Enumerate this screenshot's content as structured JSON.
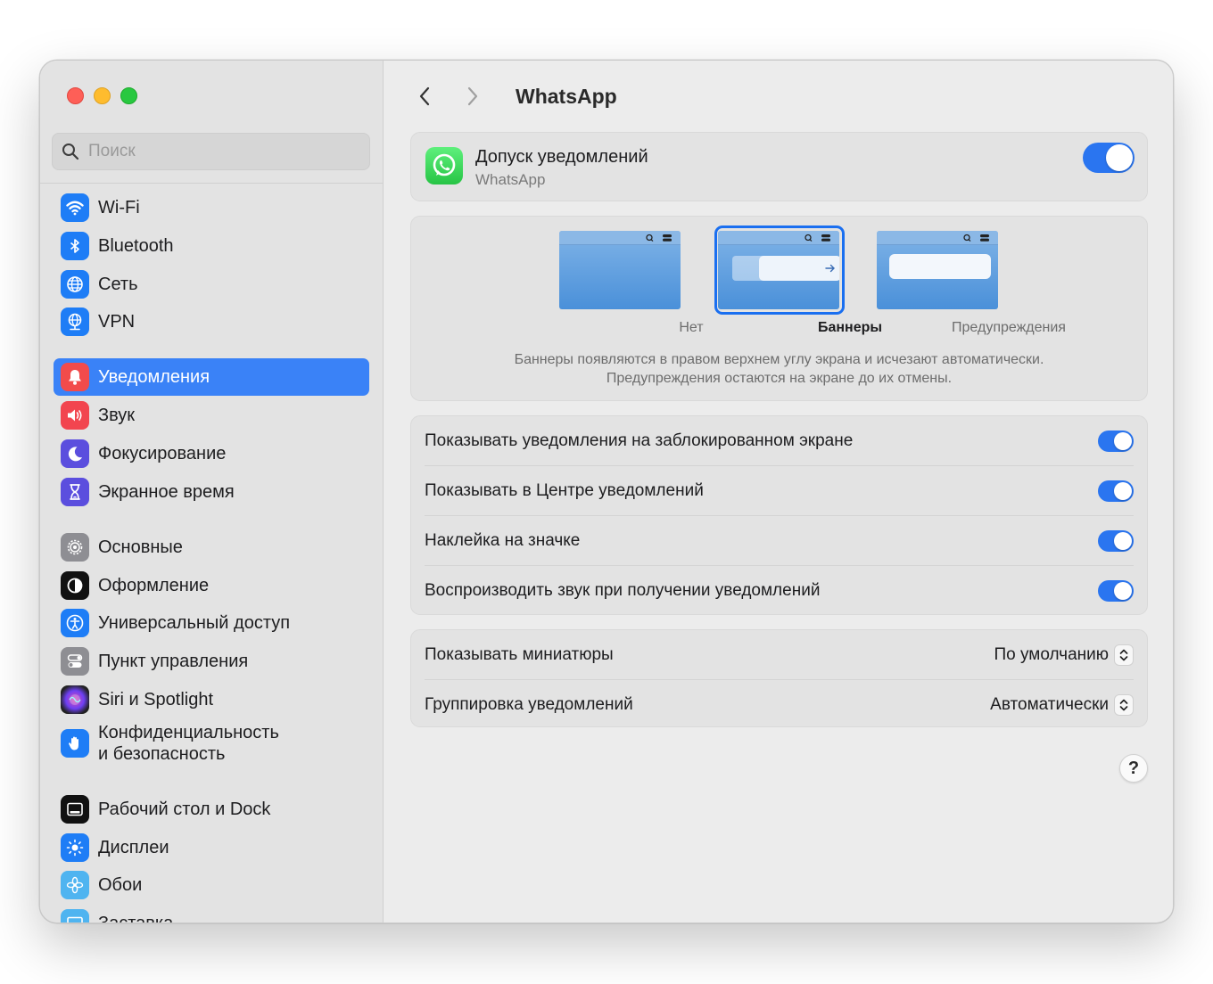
{
  "search": {
    "placeholder": "Поиск"
  },
  "sidebar": {
    "items": [
      {
        "label": "Wi-Fi",
        "icon": "wifi-icon",
        "color": "#1e7df6"
      },
      {
        "label": "Bluetooth",
        "icon": "bluetooth-icon",
        "color": "#1e7df6"
      },
      {
        "label": "Сеть",
        "icon": "globe-icon",
        "color": "#1e7df6"
      },
      {
        "label": "VPN",
        "icon": "vpn-globe-icon",
        "color": "#1e7df6"
      },
      {
        "label": "Уведомления",
        "icon": "bell-icon",
        "color": "#f24b4b",
        "active": true
      },
      {
        "label": "Звук",
        "icon": "speaker-icon",
        "color": "#f2454f"
      },
      {
        "label": "Фокусирование",
        "icon": "moon-icon",
        "color": "#5b4ede"
      },
      {
        "label": "Экранное время",
        "icon": "hourglass-icon",
        "color": "#5b4ede"
      },
      {
        "label": "Основные",
        "icon": "gear-icon",
        "color": "#8e8e93"
      },
      {
        "label": "Оформление",
        "icon": "appearance-icon",
        "color": "#111111"
      },
      {
        "label": "Универсальный доступ",
        "icon": "accessibility-icon",
        "color": "#1e7df6"
      },
      {
        "label": "Пункт управления",
        "icon": "control-center-icon",
        "color": "#8e8e93"
      },
      {
        "label": "Siri и Spotlight",
        "icon": "siri-icon",
        "color": "#3a2a6a"
      },
      {
        "label": "Конфиденциальность",
        "label2": "и безопасность",
        "icon": "hand-icon",
        "color": "#1e7df6"
      },
      {
        "label": "Рабочий стол и Dock",
        "icon": "dock-icon",
        "color": "#111111"
      },
      {
        "label": "Дисплеи",
        "icon": "display-brightness-icon",
        "color": "#1e7df6"
      },
      {
        "label": "Обои",
        "icon": "wallpaper-flower-icon",
        "color": "#4fb4f0"
      },
      {
        "label": "Заставка",
        "icon": "screensaver-icon",
        "color": "#4fb4f0"
      }
    ]
  },
  "header": {
    "title": "WhatsApp"
  },
  "app": {
    "title": "Допуск уведомлений",
    "subtitle": "WhatsApp",
    "allow_enabled": true
  },
  "alert_styles": {
    "options": [
      {
        "label": "Нет"
      },
      {
        "label": "Баннеры",
        "selected": true
      },
      {
        "label": "Предупреждения"
      }
    ],
    "description_line1": "Баннеры появляются в правом верхнем углу экрана и исчезают автоматически.",
    "description_line2": "Предупреждения остаются на экране до их отмены."
  },
  "toggles": [
    {
      "label": "Показывать уведомления на заблокированном экране",
      "enabled": true
    },
    {
      "label": "Показывать в Центре уведомлений",
      "enabled": true
    },
    {
      "label": "Наклейка на значке",
      "enabled": true
    },
    {
      "label": "Воспроизводить звук при получении уведомлений",
      "enabled": true
    }
  ],
  "options": [
    {
      "label": "Показывать миниатюры",
      "value": "По умолчанию"
    },
    {
      "label": "Группировка уведомлений",
      "value": "Автоматически"
    }
  ],
  "help": {
    "label": "?"
  },
  "colors": {
    "accent": "#3a82f7",
    "toggle_on": "#2a75f0"
  }
}
